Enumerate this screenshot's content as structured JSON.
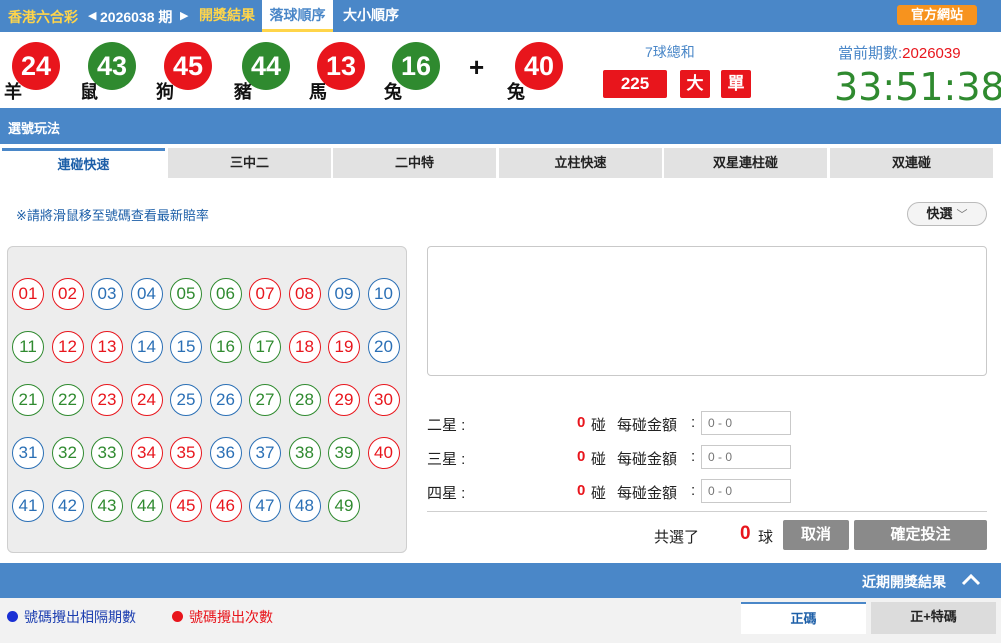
{
  "topbar": {
    "brand": "香港六合彩",
    "period": "2026038 期",
    "tab_results": "開獎結果",
    "tab_fall_order": "落球順序",
    "tab_size_order": "大小順序",
    "official_site": "官方網站"
  },
  "draw": {
    "balls": [
      {
        "num": "24",
        "zodiac": "羊",
        "color": "red"
      },
      {
        "num": "43",
        "zodiac": "鼠",
        "color": "green"
      },
      {
        "num": "45",
        "zodiac": "狗",
        "color": "red"
      },
      {
        "num": "44",
        "zodiac": "豬",
        "color": "green"
      },
      {
        "num": "13",
        "zodiac": "馬",
        "color": "red"
      },
      {
        "num": "16",
        "zodiac": "兔",
        "color": "green"
      }
    ],
    "plus": "+",
    "special": {
      "num": "40",
      "zodiac": "兔",
      "color": "red"
    },
    "sum_label": "7球總和",
    "sum_value": "225",
    "sum_big": "大",
    "sum_odd": "單",
    "current_label": "當前期數:",
    "current_period": "2026039",
    "countdown": "33:51:38"
  },
  "section": {
    "title": "選號玩法"
  },
  "play_tabs": [
    "連碰快速",
    "三中二",
    "二中特",
    "立柱快速",
    "双星連柱碰",
    "双連碰"
  ],
  "hint": "※請將滑鼠移至號碼查看最新賠率",
  "quick_pick": "快選",
  "numbers": [
    {
      "n": "01",
      "c": "red"
    },
    {
      "n": "02",
      "c": "red"
    },
    {
      "n": "03",
      "c": "blue"
    },
    {
      "n": "04",
      "c": "blue"
    },
    {
      "n": "05",
      "c": "green"
    },
    {
      "n": "06",
      "c": "green"
    },
    {
      "n": "07",
      "c": "red"
    },
    {
      "n": "08",
      "c": "red"
    },
    {
      "n": "09",
      "c": "blue"
    },
    {
      "n": "10",
      "c": "blue"
    },
    {
      "n": "11",
      "c": "green"
    },
    {
      "n": "12",
      "c": "red"
    },
    {
      "n": "13",
      "c": "red"
    },
    {
      "n": "14",
      "c": "blue"
    },
    {
      "n": "15",
      "c": "blue"
    },
    {
      "n": "16",
      "c": "green"
    },
    {
      "n": "17",
      "c": "green"
    },
    {
      "n": "18",
      "c": "red"
    },
    {
      "n": "19",
      "c": "red"
    },
    {
      "n": "20",
      "c": "blue"
    },
    {
      "n": "21",
      "c": "green"
    },
    {
      "n": "22",
      "c": "green"
    },
    {
      "n": "23",
      "c": "red"
    },
    {
      "n": "24",
      "c": "red"
    },
    {
      "n": "25",
      "c": "blue"
    },
    {
      "n": "26",
      "c": "blue"
    },
    {
      "n": "27",
      "c": "green"
    },
    {
      "n": "28",
      "c": "green"
    },
    {
      "n": "29",
      "c": "red"
    },
    {
      "n": "30",
      "c": "red"
    },
    {
      "n": "31",
      "c": "blue"
    },
    {
      "n": "32",
      "c": "green"
    },
    {
      "n": "33",
      "c": "green"
    },
    {
      "n": "34",
      "c": "red"
    },
    {
      "n": "35",
      "c": "red"
    },
    {
      "n": "36",
      "c": "blue"
    },
    {
      "n": "37",
      "c": "blue"
    },
    {
      "n": "38",
      "c": "green"
    },
    {
      "n": "39",
      "c": "green"
    },
    {
      "n": "40",
      "c": "red"
    },
    {
      "n": "41",
      "c": "blue"
    },
    {
      "n": "42",
      "c": "blue"
    },
    {
      "n": "43",
      "c": "green"
    },
    {
      "n": "44",
      "c": "green"
    },
    {
      "n": "45",
      "c": "red"
    },
    {
      "n": "46",
      "c": "red"
    },
    {
      "n": "47",
      "c": "blue"
    },
    {
      "n": "48",
      "c": "blue"
    },
    {
      "n": "49",
      "c": "green"
    }
  ],
  "bets": [
    {
      "label": "二星  :",
      "count": "0",
      "pong": "碰",
      "amount_label": "每碰金額",
      "colon": ":",
      "placeholder": "0 - 0"
    },
    {
      "label": "三星  :",
      "count": "0",
      "pong": "碰",
      "amount_label": "每碰金額",
      "colon": ":",
      "placeholder": "0 - 0"
    },
    {
      "label": "四星  :",
      "count": "0",
      "pong": "碰",
      "amount_label": "每碰金額",
      "colon": ":",
      "placeholder": "0 - 0"
    }
  ],
  "selected": {
    "prefix": "共選了",
    "count": "0",
    "unit": "球"
  },
  "buttons": {
    "cancel": "取消",
    "confirm": "確定投注"
  },
  "recent": {
    "title": "近期開獎結果"
  },
  "legend": {
    "gap": "號碼攪出相隔期數",
    "times": "號碼攪出次數"
  },
  "bottom_tabs": [
    "正碼",
    "正+特碼"
  ],
  "colors": {
    "red": "#e8151c",
    "green": "#2f8a2f",
    "blue": "#2a6fb5",
    "header": "#4a87c8"
  }
}
